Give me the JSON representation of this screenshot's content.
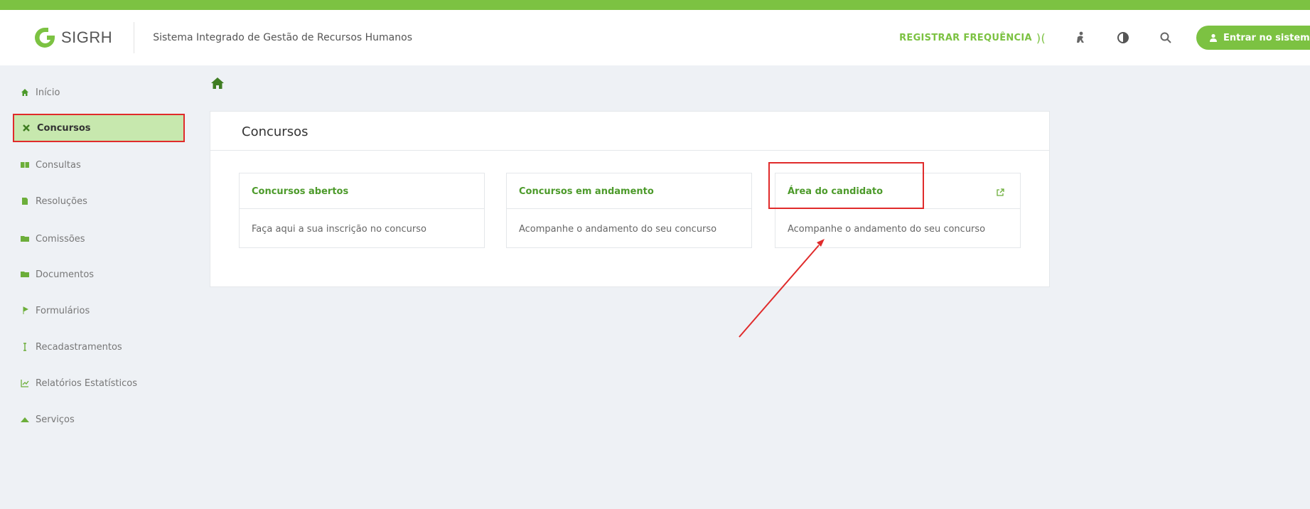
{
  "header": {
    "logo_text": "SIGRH",
    "system_name": "Sistema Integrado de Gestão de Recursos Humanos",
    "register_attendance": "REGISTRAR FREQUÊNCIA",
    "login_label": "Entrar no sistema",
    "icons": [
      "fingerprint-icon",
      "accessibility-icon",
      "contrast-icon",
      "search-icon",
      "user-icon"
    ]
  },
  "sidebar": {
    "items": [
      {
        "label": "Início",
        "icon": "home-icon"
      },
      {
        "label": "Concursos",
        "icon": "tools-icon"
      },
      {
        "label": "Consultas",
        "icon": "table-icon"
      },
      {
        "label": "Resoluções",
        "icon": "file-icon"
      },
      {
        "label": "Comissões",
        "icon": "folder-icon"
      },
      {
        "label": "Documentos",
        "icon": "folder-icon"
      },
      {
        "label": "Formulários",
        "icon": "flag-icon"
      },
      {
        "label": "Recadastramentos",
        "icon": "id-icon"
      },
      {
        "label": "Relatórios Estatísticos",
        "icon": "chart-icon"
      },
      {
        "label": "Serviços",
        "icon": "mountain-icon"
      }
    ],
    "active": "Concursos"
  },
  "main": {
    "panel_title": "Concursos",
    "cards": [
      {
        "title": "Concursos abertos",
        "description": "Faça aqui a sua inscrição no concurso"
      },
      {
        "title": "Concursos em andamento",
        "description": "Acompanhe o andamento do seu concurso"
      },
      {
        "title": "Área do candidato",
        "description": "Acompanhe o andamento do seu concurso",
        "external_icon": "external-link-icon"
      }
    ]
  },
  "colors": {
    "brand_green": "#7cc242",
    "link_green": "#4c9a2a",
    "active_bg": "#c7e8ae",
    "annotation_red": "#e02b2b",
    "page_bg": "#eef1f5"
  }
}
